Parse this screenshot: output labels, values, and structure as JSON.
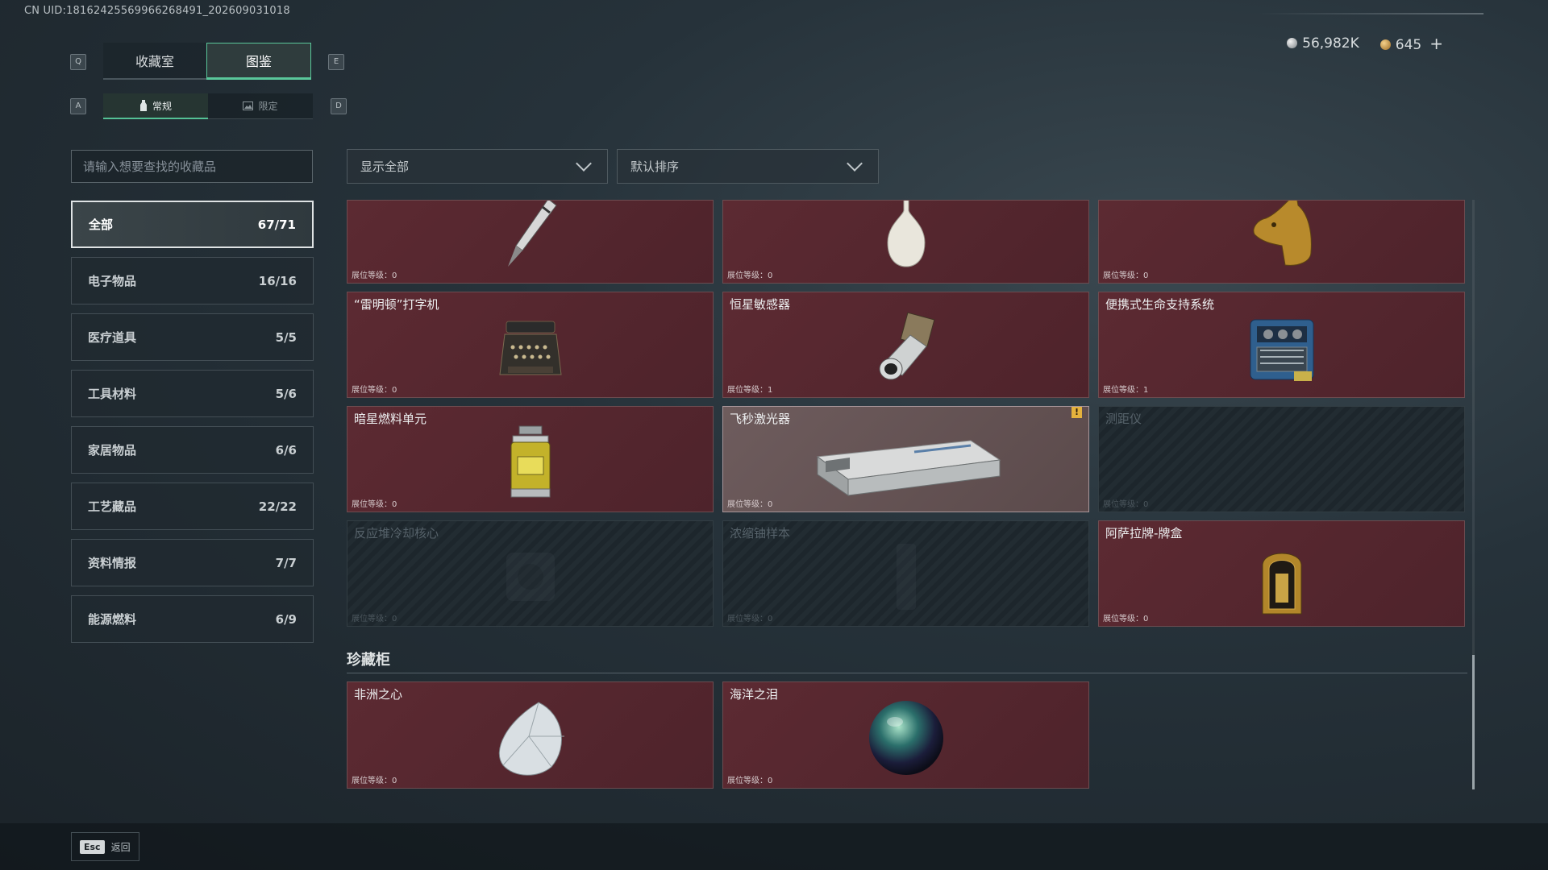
{
  "uid": "CN UID:18162425569966268491_202609031018",
  "tabs": {
    "key_left": "Q",
    "key_right": "E",
    "items": [
      {
        "label": "收藏室"
      },
      {
        "label": "图鉴"
      }
    ],
    "active_index": 1
  },
  "subtabs": {
    "key_left": "A",
    "key_right": "D",
    "items": [
      {
        "label": "常规"
      },
      {
        "label": "限定"
      }
    ]
  },
  "currency": {
    "silver": "56,982K",
    "gold": "645",
    "plus": "+"
  },
  "search": {
    "placeholder": "请输入想要查找的收藏品"
  },
  "filter": {
    "value": "显示全部"
  },
  "sort": {
    "value": "默认排序"
  },
  "categories": [
    {
      "label": "全部",
      "count": "67/71"
    },
    {
      "label": "电子物品",
      "count": "16/16"
    },
    {
      "label": "医疗道具",
      "count": "5/5"
    },
    {
      "label": "工具材料",
      "count": "5/6"
    },
    {
      "label": "家居物品",
      "count": "6/6"
    },
    {
      "label": "工艺藏品",
      "count": "22/22"
    },
    {
      "label": "资料情报",
      "count": "7/7"
    },
    {
      "label": "能源燃料",
      "count": "6/9"
    }
  ],
  "items": [
    {
      "name": "",
      "level": "展位等级：0",
      "icon": "fountain-pen"
    },
    {
      "name": "",
      "level": "展位等级：0",
      "icon": "porcelain-vase"
    },
    {
      "name": "",
      "level": "展位等级：0",
      "icon": "golden-horse-head"
    },
    {
      "name": "“雷明顿”打字机",
      "level": "展位等级：0",
      "icon": "typewriter"
    },
    {
      "name": "恒星敏感器",
      "level": "展位等级：1",
      "icon": "star-sensor"
    },
    {
      "name": "便携式生命支持系统",
      "level": "展位等级：1",
      "icon": "life-support"
    },
    {
      "name": "暗星燃料单元",
      "level": "展位等级：0",
      "icon": "fuel-cell"
    },
    {
      "name": "飞秒激光器",
      "level": "展位等级：0",
      "icon": "laser-case",
      "warning": "!"
    },
    {
      "name": "测距仪",
      "level": "展位等级：0",
      "icon": "rangefinder"
    },
    {
      "name": "反应堆冷却核心",
      "level": "展位等级：0",
      "icon": "reactor-core"
    },
    {
      "name": "浓缩铀样本",
      "level": "展位等级：0",
      "icon": "uranium-sample"
    },
    {
      "name": "阿萨拉牌-牌盒",
      "level": "展位等级：0",
      "icon": "card-box"
    }
  ],
  "treasure": {
    "title": "珍藏柜",
    "items": [
      {
        "name": "非洲之心",
        "level": "展位等级：0",
        "icon": "diamond"
      },
      {
        "name": "海洋之泪",
        "level": "展位等级：0",
        "icon": "pearl"
      }
    ]
  },
  "footer": {
    "key": "Esc",
    "label": "返回"
  }
}
